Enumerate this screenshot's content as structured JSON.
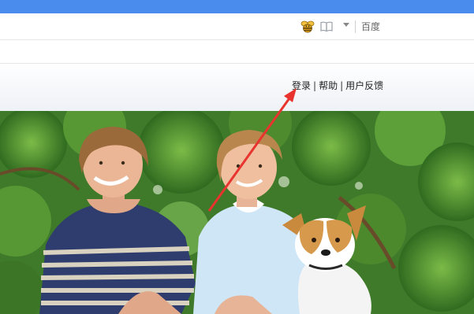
{
  "toolbar": {
    "icons": [
      "bee-icon",
      "book-icon",
      "dropdown-icon"
    ],
    "search_engine": "百度"
  },
  "header": {
    "links": {
      "login": "登录",
      "help": "帮助",
      "feedback": "用户反馈",
      "separator": "|"
    }
  },
  "banner": {
    "image": "photo-two-boys-with-dog"
  },
  "annotation": {
    "arrow_color": "#e8332e",
    "arrow_target": "login-link"
  },
  "colors": {
    "top_strip": "#4a8bee",
    "foliage": "#3f7a2a"
  }
}
